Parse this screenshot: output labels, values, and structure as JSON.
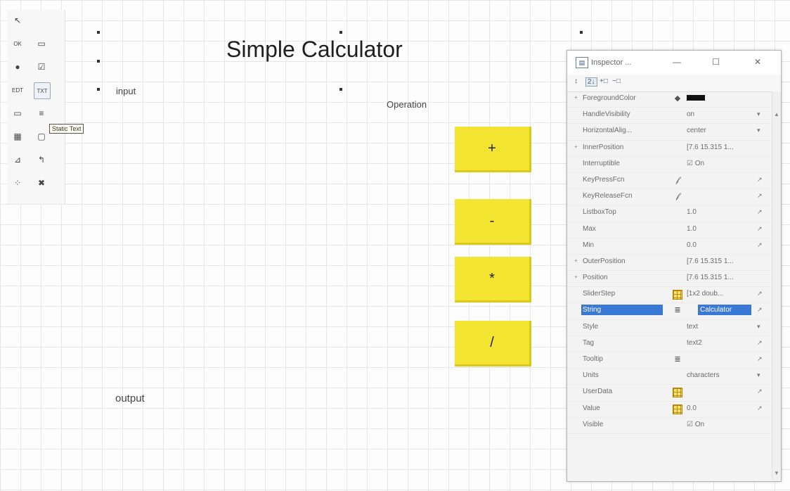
{
  "canvas": {
    "title": "Simple Calculator",
    "input_label": "input",
    "operation_label": "Operation",
    "output_label": "output",
    "buttons": {
      "add": "+",
      "subtract": "-",
      "multiply": "*",
      "divide": "/"
    }
  },
  "palette": {
    "tools": [
      {
        "name": "select-tool-icon",
        "glyph": "↖"
      },
      {
        "name": "push-button-tool-icon",
        "glyph": "OK"
      },
      {
        "name": "slider-tool-icon",
        "glyph": "▭"
      },
      {
        "name": "radio-button-tool-icon",
        "glyph": "●"
      },
      {
        "name": "checkbox-tool-icon",
        "glyph": "☑"
      },
      {
        "name": "edit-text-tool-icon",
        "glyph": "EDT"
      },
      {
        "name": "static-text-tool-icon",
        "glyph": "TXT"
      },
      {
        "name": "popup-menu-tool-icon",
        "glyph": "▭"
      },
      {
        "name": "listbox-tool-icon",
        "glyph": "≡"
      },
      {
        "name": "table-tool-icon",
        "glyph": "▦"
      },
      {
        "name": "panel-tool-icon",
        "glyph": "▢"
      },
      {
        "name": "axes-tool-icon",
        "glyph": "⊿"
      },
      {
        "name": "button-group-tool-icon",
        "glyph": "↰"
      },
      {
        "name": "activex-tool-icon",
        "glyph": "⁘"
      },
      {
        "name": "toggle-button-tool-icon",
        "glyph": "✖"
      }
    ],
    "tooltip": "Static Text"
  },
  "inspector": {
    "title": "Inspector ...",
    "minimize": "—",
    "maximize": "☐",
    "close": "✕",
    "toolbar": [
      "↕",
      "2↓",
      "+□",
      "−□"
    ],
    "rows": [
      {
        "name": "ForegroundColor",
        "icon": "paint",
        "value": "",
        "swatch": true,
        "edit": "",
        "expander": "+"
      },
      {
        "name": "HandleVisibility",
        "icon": "",
        "value": "on",
        "edit": "▾",
        "expander": ""
      },
      {
        "name": "HorizontalAlig...",
        "icon": "",
        "value": "center",
        "edit": "▾",
        "expander": ""
      },
      {
        "name": "InnerPosition",
        "icon": "",
        "value": "[7.6 15.315 1...",
        "edit": "",
        "expander": "+"
      },
      {
        "name": "Interruptible",
        "icon": "",
        "value": "☑ On",
        "edit": "",
        "expander": ""
      },
      {
        "name": "KeyPressFcn",
        "icon": "fcn",
        "value": "",
        "edit": "↗",
        "expander": ""
      },
      {
        "name": "KeyReleaseFcn",
        "icon": "fcn",
        "value": "",
        "edit": "↗",
        "expander": ""
      },
      {
        "name": "ListboxTop",
        "icon": "",
        "value": "1.0",
        "edit": "↗",
        "expander": ""
      },
      {
        "name": "Max",
        "icon": "",
        "value": "1.0",
        "edit": "↗",
        "expander": ""
      },
      {
        "name": "Min",
        "icon": "",
        "value": "0.0",
        "edit": "↗",
        "expander": ""
      },
      {
        "name": "OuterPosition",
        "icon": "",
        "value": "[7.6 15.315 1...",
        "edit": "",
        "expander": "+"
      },
      {
        "name": "Position",
        "icon": "",
        "value": "[7.6 15.315 1...",
        "edit": "",
        "expander": "+"
      },
      {
        "name": "SliderStep",
        "icon": "grid",
        "value": "[1x2 doub...",
        "edit": "↗",
        "expander": ""
      },
      {
        "name": "String",
        "icon": "text",
        "value": "Calculator",
        "edit": "↗",
        "expander": "",
        "selected": true
      },
      {
        "name": "Style",
        "icon": "",
        "value": "text",
        "edit": "▾",
        "expander": ""
      },
      {
        "name": "Tag",
        "icon": "",
        "value": "text2",
        "edit": "↗",
        "expander": ""
      },
      {
        "name": "Tooltip",
        "icon": "text",
        "value": "",
        "edit": "↗",
        "expander": ""
      },
      {
        "name": "Units",
        "icon": "",
        "value": "characters",
        "edit": "▾",
        "expander": ""
      },
      {
        "name": "UserData",
        "icon": "grid",
        "value": "",
        "edit": "↗",
        "expander": ""
      },
      {
        "name": "Value",
        "icon": "grid",
        "value": "0.0",
        "edit": "↗",
        "expander": ""
      },
      {
        "name": "Visible",
        "icon": "",
        "value": "☑ On",
        "edit": "",
        "expander": ""
      }
    ]
  }
}
